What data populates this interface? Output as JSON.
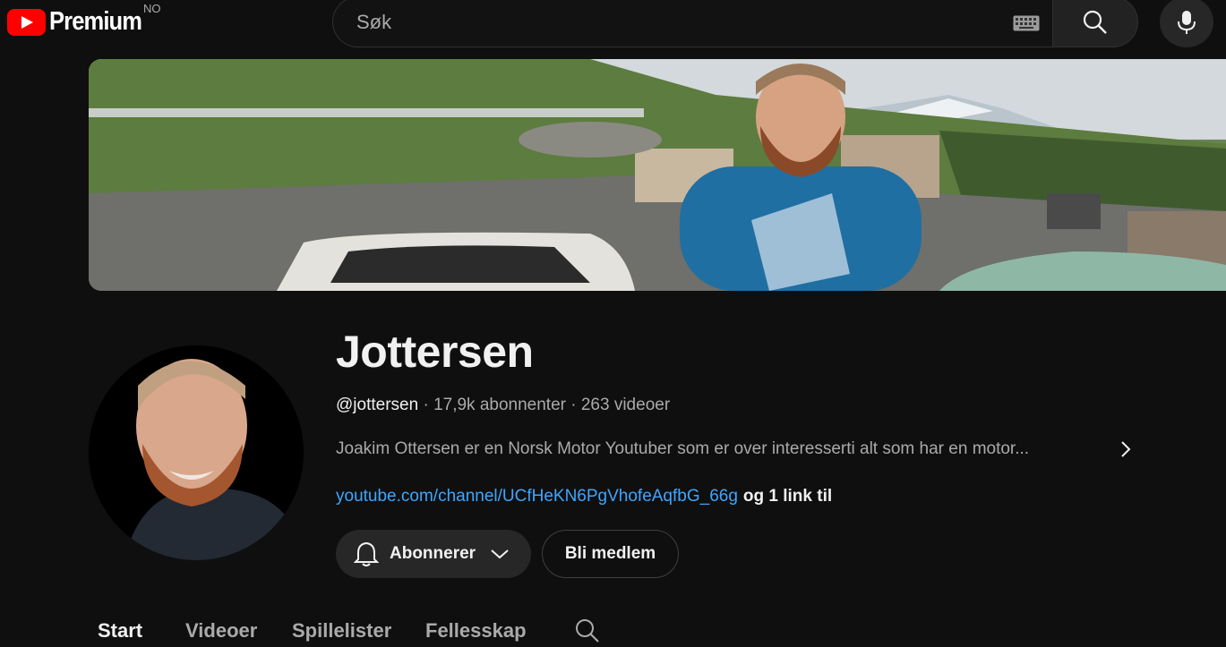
{
  "header": {
    "logo_text": "Premium",
    "country_code": "NO",
    "search": {
      "placeholder": "Søk",
      "value": ""
    }
  },
  "channel": {
    "name": "Jottersen",
    "handle": "@jottersen",
    "subscribers": "17,9k abonnenter",
    "videos": "263 videoer",
    "separator": "·",
    "description": "Joakim Ottersen er en Norsk Motor Youtuber som er over interesserti alt som har en motor...",
    "link": "youtube.com/channel/UCfHeKN6PgVhofeAqfbG_66g",
    "more_links": "og 1 link til"
  },
  "actions": {
    "subscribe_label": "Abonnerer",
    "join_label": "Bli medlem"
  },
  "tabs": [
    {
      "label": "Start",
      "active": true
    },
    {
      "label": "Videoer",
      "active": false
    },
    {
      "label": "Spillelister",
      "active": false
    },
    {
      "label": "Fellesskap",
      "active": false
    }
  ],
  "colors": {
    "background": "#0f0f0f",
    "brand_red": "#ff0000",
    "link_blue": "#3ea6ff",
    "secondary_text": "#aaaaaa"
  },
  "icons": [
    "youtube-logo-icon",
    "keyboard-icon",
    "search-icon",
    "microphone-icon",
    "bell-icon",
    "chevron-down-icon",
    "chevron-right-icon"
  ]
}
